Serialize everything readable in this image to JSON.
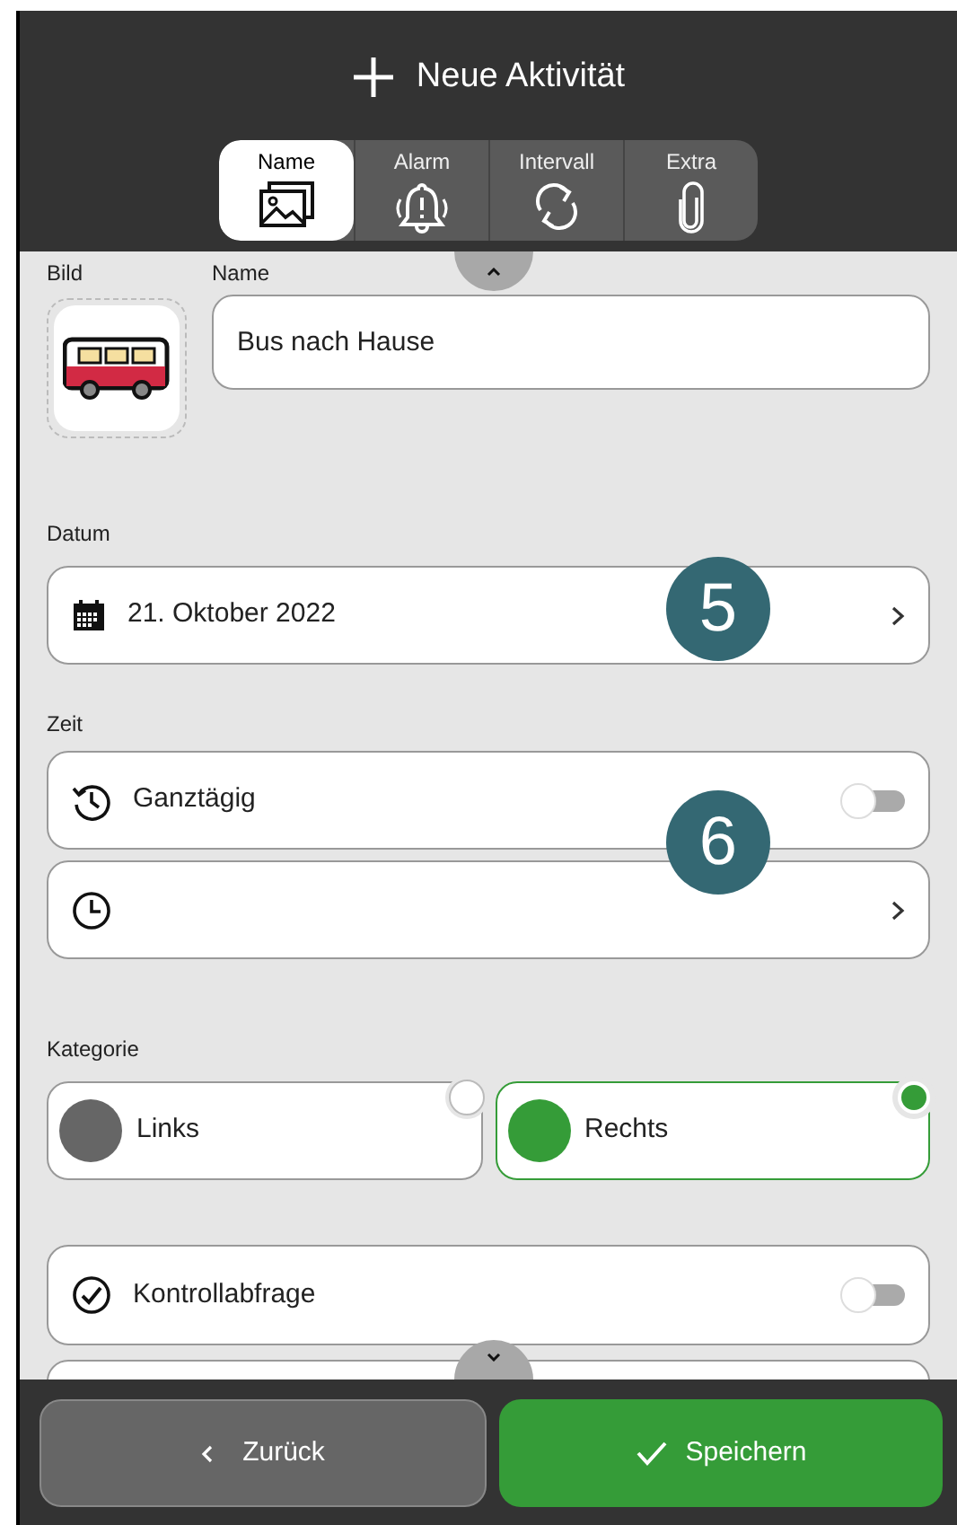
{
  "header": {
    "title": "Neue Aktivität"
  },
  "tabs": [
    {
      "label": "Name",
      "selected": true,
      "kind": "pictures"
    },
    {
      "label": "Alarm",
      "selected": false,
      "kind": "bell"
    },
    {
      "label": "Intervall",
      "selected": false,
      "kind": "cycle"
    },
    {
      "label": "Extra",
      "selected": false,
      "kind": "clip"
    }
  ],
  "image_label": "Bild",
  "name_label": "Name",
  "name_value": "Bus nach Hause",
  "date": {
    "label": "Datum",
    "value": "21. Oktober 2022"
  },
  "time": {
    "label": "Zeit",
    "all_day": {
      "label": "Ganztägig",
      "on": false
    }
  },
  "category": {
    "label": "Kategorie",
    "options": [
      {
        "label": "Links",
        "color": "#666666",
        "selected": false
      },
      {
        "label": "Rechts",
        "color": "#359c38",
        "selected": true
      }
    ]
  },
  "check": {
    "label": "Kontrollabfrage",
    "on": false
  },
  "markers": [
    "5",
    "6"
  ],
  "buttons": {
    "back": "Zurück",
    "save": "Speichern"
  }
}
